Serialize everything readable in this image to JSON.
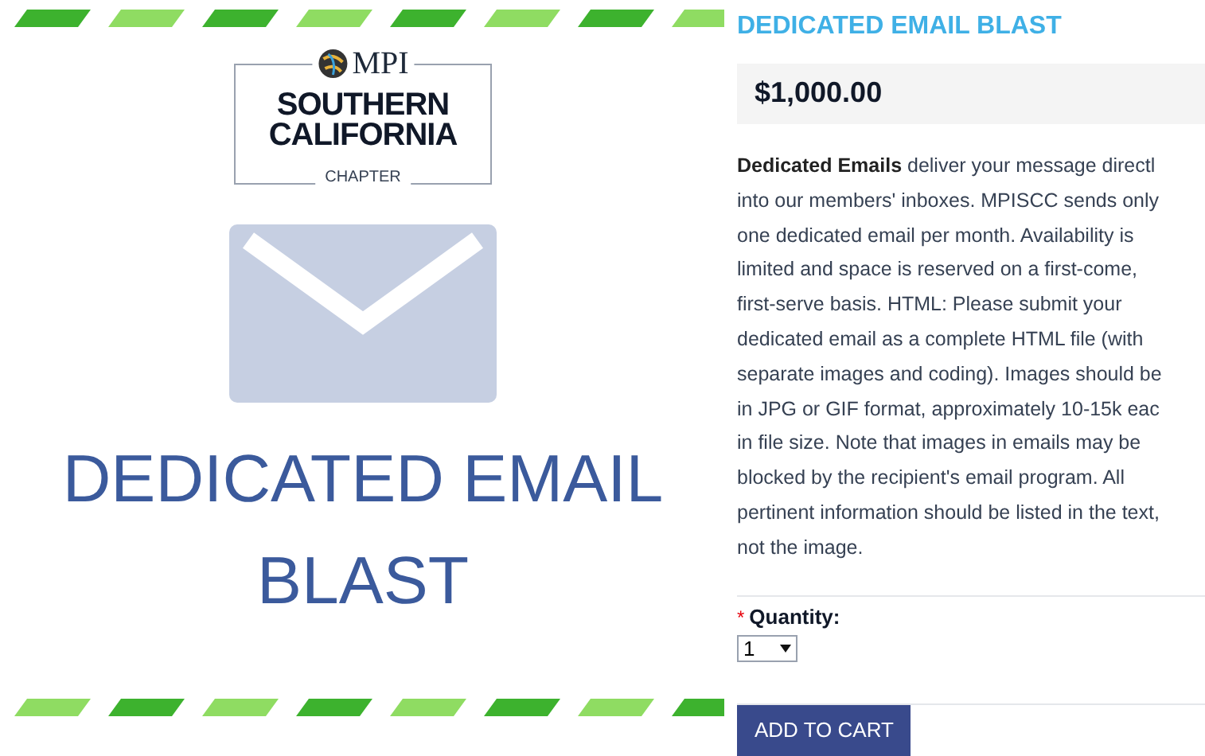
{
  "product_image": {
    "logo": {
      "brand": "MPI",
      "line_1": "SOUTHERN",
      "line_2": "CALIFORNIA",
      "chapter": "CHAPTER"
    },
    "caption_lines": [
      "DEDICATED EMAIL",
      "BLAST"
    ]
  },
  "product": {
    "title": "DEDICATED EMAIL BLAST",
    "price": "$1,000.00",
    "description_lines": [
      "**Dedicated Emails** deliver your message directl",
      "into our members' inboxes. MPISCC sends only",
      "one dedicated email per month. Availability is",
      "limited and space is reserved on a first-come,",
      "first-serve basis.  HTML: Please submit your",
      "dedicated email as a complete HTML file (with",
      "separate images and coding). Images should be",
      "in JPG or GIF format, approximately 10-15k eac",
      "in file size. Note that images in emails may be",
      "blocked by the recipient's email program. All",
      "pertinent information should be listed in the text,",
      "not the image."
    ],
    "quantity": {
      "required_mark": "*",
      "label": "Quantity:",
      "value": "1"
    },
    "add_button": "ADD TO CART"
  }
}
